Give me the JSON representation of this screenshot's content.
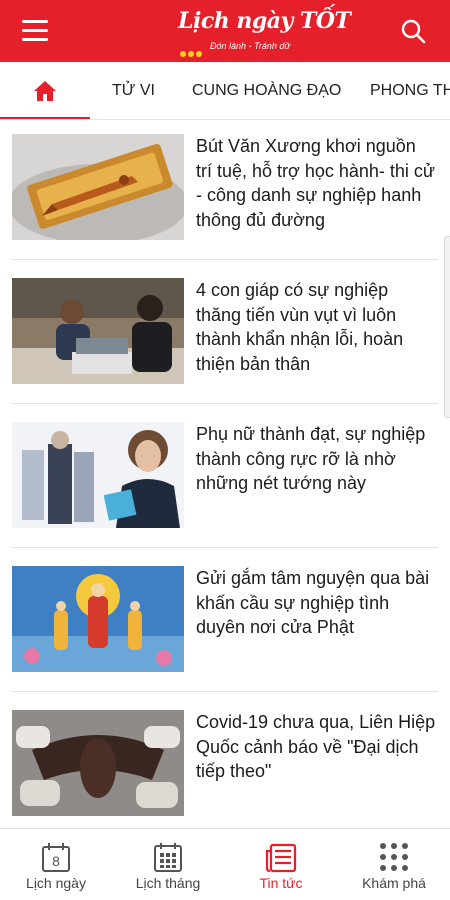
{
  "header": {
    "logo_text": "Lịch ngày TỐT",
    "logo_tagline": "Đón lành - Tránh dữ",
    "accent_color": "#e6202b"
  },
  "tabs": [
    {
      "label": "home-icon",
      "active": true
    },
    {
      "label": "TỬ VI"
    },
    {
      "label": "CUNG HOÀNG ĐẠO"
    },
    {
      "label": "PHONG THỦY"
    }
  ],
  "articles": [
    {
      "title": "Bút Văn Xương khơi nguồn trí tuệ, hỗ trợ học hành- thi cử - công danh sự nghiệp hanh thông đủ đường",
      "image": "gold-pen-in-box"
    },
    {
      "title": "4 con giáp có sự nghiệp thăng tiến vùn vụt vì luôn thành khẩn nhận lỗi, hoàn thiện bản thân",
      "image": "office-workers-laptop"
    },
    {
      "title": "Phụ nữ thành đạt, sự nghiệp thành công rực rỡ là nhờ những nét tướng này",
      "image": "businesswoman"
    },
    {
      "title": "Gửi gắm tâm nguyện qua bài khấn cầu sự nghiệp tình duyên nơi cửa Phật",
      "image": "buddha-painting"
    },
    {
      "title": "Covid-19 chưa qua, Liên Hiệp Quốc cảnh báo về \"Đại dịch tiếp theo\"",
      "image": "bat-held-by-gloved-hands"
    }
  ],
  "bottom_nav": [
    {
      "label": "Lịch ngày",
      "icon": "calendar-day-icon",
      "day": "8"
    },
    {
      "label": "Lịch tháng",
      "icon": "calendar-month-icon"
    },
    {
      "label": "Tin tức",
      "icon": "news-icon",
      "active": true
    },
    {
      "label": "Khám phá",
      "icon": "grid-dots-icon"
    }
  ]
}
